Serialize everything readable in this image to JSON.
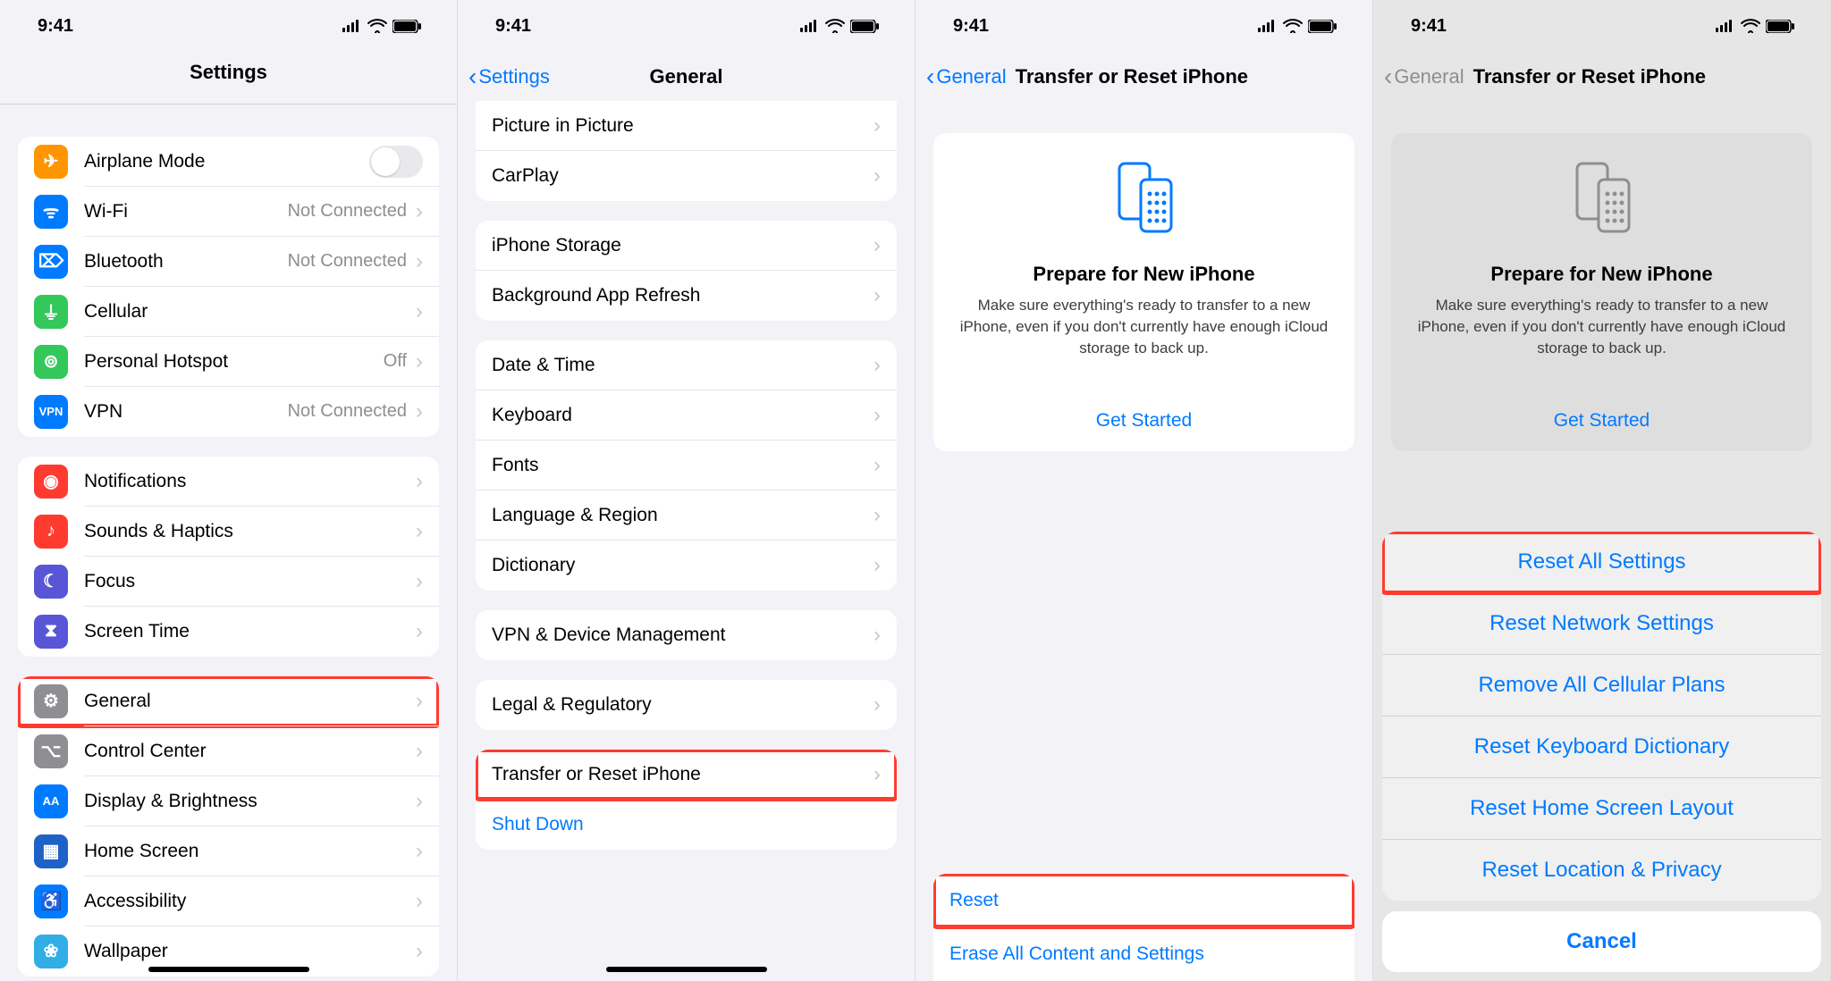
{
  "status": {
    "time": "9:41"
  },
  "screen1": {
    "title": "Settings",
    "groups": [
      {
        "items": [
          {
            "icon": "airplane-icon",
            "iconColor": "ic-orange",
            "label": "Airplane Mode",
            "type": "toggle"
          },
          {
            "icon": "wifi-icon",
            "iconColor": "ic-blue",
            "label": "Wi-Fi",
            "detail": "Not Connected",
            "type": "disclosure"
          },
          {
            "icon": "bluetooth-icon",
            "iconColor": "ic-blue",
            "label": "Bluetooth",
            "detail": "Not Connected",
            "type": "disclosure"
          },
          {
            "icon": "cellular-icon",
            "iconColor": "ic-green",
            "label": "Cellular",
            "type": "disclosure"
          },
          {
            "icon": "hotspot-icon",
            "iconColor": "ic-green",
            "label": "Personal Hotspot",
            "detail": "Off",
            "type": "disclosure"
          },
          {
            "icon": "vpn-icon",
            "iconColor": "ic-blue",
            "label": "VPN",
            "detail": "Not Connected",
            "type": "disclosure"
          }
        ]
      },
      {
        "items": [
          {
            "icon": "notifications-icon",
            "iconColor": "ic-red",
            "label": "Notifications",
            "type": "disclosure"
          },
          {
            "icon": "sounds-icon",
            "iconColor": "ic-red",
            "label": "Sounds & Haptics",
            "type": "disclosure"
          },
          {
            "icon": "focus-icon",
            "iconColor": "ic-purple",
            "label": "Focus",
            "type": "disclosure"
          },
          {
            "icon": "screentime-icon",
            "iconColor": "ic-purple",
            "label": "Screen Time",
            "type": "disclosure"
          }
        ]
      },
      {
        "items": [
          {
            "icon": "gear-icon",
            "iconColor": "ic-gray",
            "label": "General",
            "type": "disclosure",
            "highlight": true
          },
          {
            "icon": "control-center-icon",
            "iconColor": "ic-gray",
            "label": "Control Center",
            "type": "disclosure"
          },
          {
            "icon": "display-icon",
            "iconColor": "ic-blue",
            "label": "Display & Brightness",
            "type": "disclosure"
          },
          {
            "icon": "home-screen-icon",
            "iconColor": "ic-bluedark",
            "label": "Home Screen",
            "type": "disclosure"
          },
          {
            "icon": "accessibility-icon",
            "iconColor": "ic-blue",
            "label": "Accessibility",
            "type": "disclosure"
          },
          {
            "icon": "wallpaper-icon",
            "iconColor": "ic-teal",
            "label": "Wallpaper",
            "type": "disclosure"
          }
        ]
      }
    ]
  },
  "screen2": {
    "back": "Settings",
    "title": "General",
    "groups": [
      {
        "continued": true,
        "items": [
          {
            "label": "Picture in Picture",
            "type": "disclosure"
          },
          {
            "label": "CarPlay",
            "type": "disclosure"
          }
        ]
      },
      {
        "items": [
          {
            "label": "iPhone Storage",
            "type": "disclosure"
          },
          {
            "label": "Background App Refresh",
            "type": "disclosure"
          }
        ]
      },
      {
        "items": [
          {
            "label": "Date & Time",
            "type": "disclosure"
          },
          {
            "label": "Keyboard",
            "type": "disclosure"
          },
          {
            "label": "Fonts",
            "type": "disclosure"
          },
          {
            "label": "Language & Region",
            "type": "disclosure"
          },
          {
            "label": "Dictionary",
            "type": "disclosure"
          }
        ]
      },
      {
        "items": [
          {
            "label": "VPN & Device Management",
            "type": "disclosure"
          }
        ]
      },
      {
        "items": [
          {
            "label": "Legal & Regulatory",
            "type": "disclosure"
          }
        ]
      },
      {
        "items": [
          {
            "label": "Transfer or Reset iPhone",
            "type": "disclosure",
            "highlight": true
          },
          {
            "label": "Shut Down",
            "type": "text",
            "blue": true
          }
        ]
      }
    ]
  },
  "screen3": {
    "back": "General",
    "title": "Transfer or Reset iPhone",
    "card": {
      "heading": "Prepare for New iPhone",
      "body": "Make sure everything's ready to transfer to a new iPhone, even if you don't currently have enough iCloud storage to back up.",
      "cta": "Get Started"
    },
    "bottom": [
      {
        "label": "Reset",
        "highlight": true
      },
      {
        "label": "Erase All Content and Settings"
      }
    ]
  },
  "screen4": {
    "back": "General",
    "title": "Transfer or Reset iPhone",
    "card": {
      "heading": "Prepare for New iPhone",
      "body": "Make sure everything's ready to transfer to a new iPhone, even if you don't currently have enough iCloud storage to back up.",
      "cta": "Get Started"
    },
    "sheet": {
      "items": [
        {
          "label": "Reset All Settings",
          "highlight": true
        },
        {
          "label": "Reset Network Settings"
        },
        {
          "label": "Remove All Cellular Plans"
        },
        {
          "label": "Reset Keyboard Dictionary"
        },
        {
          "label": "Reset Home Screen Layout"
        },
        {
          "label": "Reset Location & Privacy"
        }
      ],
      "cancel": "Cancel"
    }
  }
}
